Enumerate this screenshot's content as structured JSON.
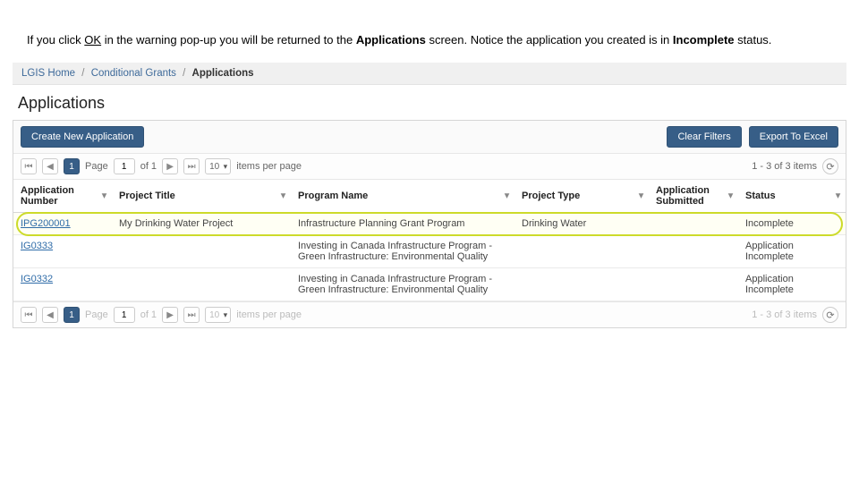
{
  "instruction": {
    "pre": "If you click ",
    "ok": "OK",
    "mid1": " in the warning pop-up you will be returned to the ",
    "apps": "Applications",
    "mid2": " screen. Notice the application you created is in ",
    "incomplete": "Incomplete",
    "post": " status."
  },
  "breadcrumbs": {
    "home": "LGIS Home",
    "mid": "Conditional Grants",
    "current": "Applications"
  },
  "page_title": "Applications",
  "toolbar": {
    "create": "Create New Application",
    "clear": "Clear Filters",
    "export": "Export To Excel"
  },
  "pager": {
    "page_label": "Page",
    "page_num": "1",
    "of": "of 1",
    "per_page_value": "10",
    "per_page_label": "items per page",
    "summary": "1 - 3 of 3 items"
  },
  "columns": {
    "num": "Application Number",
    "title": "Project Title",
    "prog": "Program Name",
    "type": "Project Type",
    "sub": "Application Submitted",
    "stat": "Status"
  },
  "rows": [
    {
      "num": "IPG200001",
      "title": "My Drinking Water Project",
      "prog": "Infrastructure Planning Grant Program",
      "type": "Drinking Water",
      "sub": "",
      "stat": "Incomplete",
      "highlight": true
    },
    {
      "num": "IG0333",
      "title": "",
      "prog": "Investing in Canada Infrastructure Program - Green Infrastructure: Environmental Quality",
      "type": "",
      "sub": "",
      "stat": "Application Incomplete"
    },
    {
      "num": "IG0332",
      "title": "",
      "prog": "Investing in Canada Infrastructure Program - Green Infrastructure: Environmental Quality",
      "type": "",
      "sub": "",
      "stat": "Application Incomplete"
    }
  ]
}
